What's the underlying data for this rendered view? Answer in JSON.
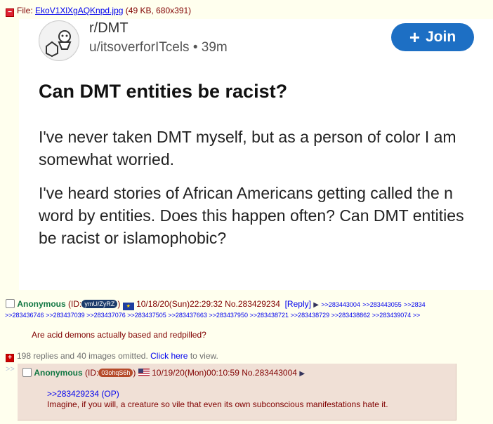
{
  "file": {
    "prefix": "File:",
    "name": "EkoV1XlXgAQKnpd.jpg",
    "info": "(49 KB, 680x391)"
  },
  "image": {
    "subreddit": "r/DMT",
    "user": "u/itsoverforITcels",
    "age": "39m",
    "join_label": "Join",
    "title": "Can DMT entities be racist?",
    "paragraphs": [
      "I've never taken DMT myself, but as a person of color I am somewhat worried.",
      "I've heard stories of African Americans getting called the n  word by entities. Does this happen often? Can DMT entities be racist or islamophobic?"
    ]
  },
  "op": {
    "name": "Anonymous",
    "id_prefix": "(ID:",
    "id": "ymU/ZyRZ",
    "id_suffix": ")",
    "datetime": "10/18/20(Sun)22:29:32",
    "no": "No.283429234",
    "reply_label": "[Reply]",
    "backlinks_row1": [
      ">>283443004",
      ">>283443055",
      ">>2834"
    ],
    "backlinks_row2": [
      ">>283436746",
      ">>283437039",
      ">>283437076",
      ">>283437505",
      ">>283437663",
      ">>283437950",
      ">>283438721",
      ">>283438729",
      ">>283438862",
      ">>283439074",
      ">>"
    ],
    "comment": "Are acid demons actually based and redpilled?"
  },
  "omitted": {
    "text": "198 replies and 40 images omitted.",
    "link": "Click here",
    "suffix": "to view."
  },
  "reply": {
    "arrow": ">>",
    "name": "Anonymous",
    "id_prefix": "(ID:",
    "id": "03ohqS6h",
    "id_suffix": ")",
    "datetime": "10/19/20(Mon)00:10:59",
    "no": "No.283443004",
    "quote": ">>283429234 (OP)",
    "comment": "Imagine, if you will, a creature so vile that even its own subconscious manifestations hate it."
  },
  "colors": {
    "background": "#ffffee",
    "name_green": "#117743",
    "reply_bg": "#f0e0d6",
    "join_blue": "#1d6fc4"
  }
}
